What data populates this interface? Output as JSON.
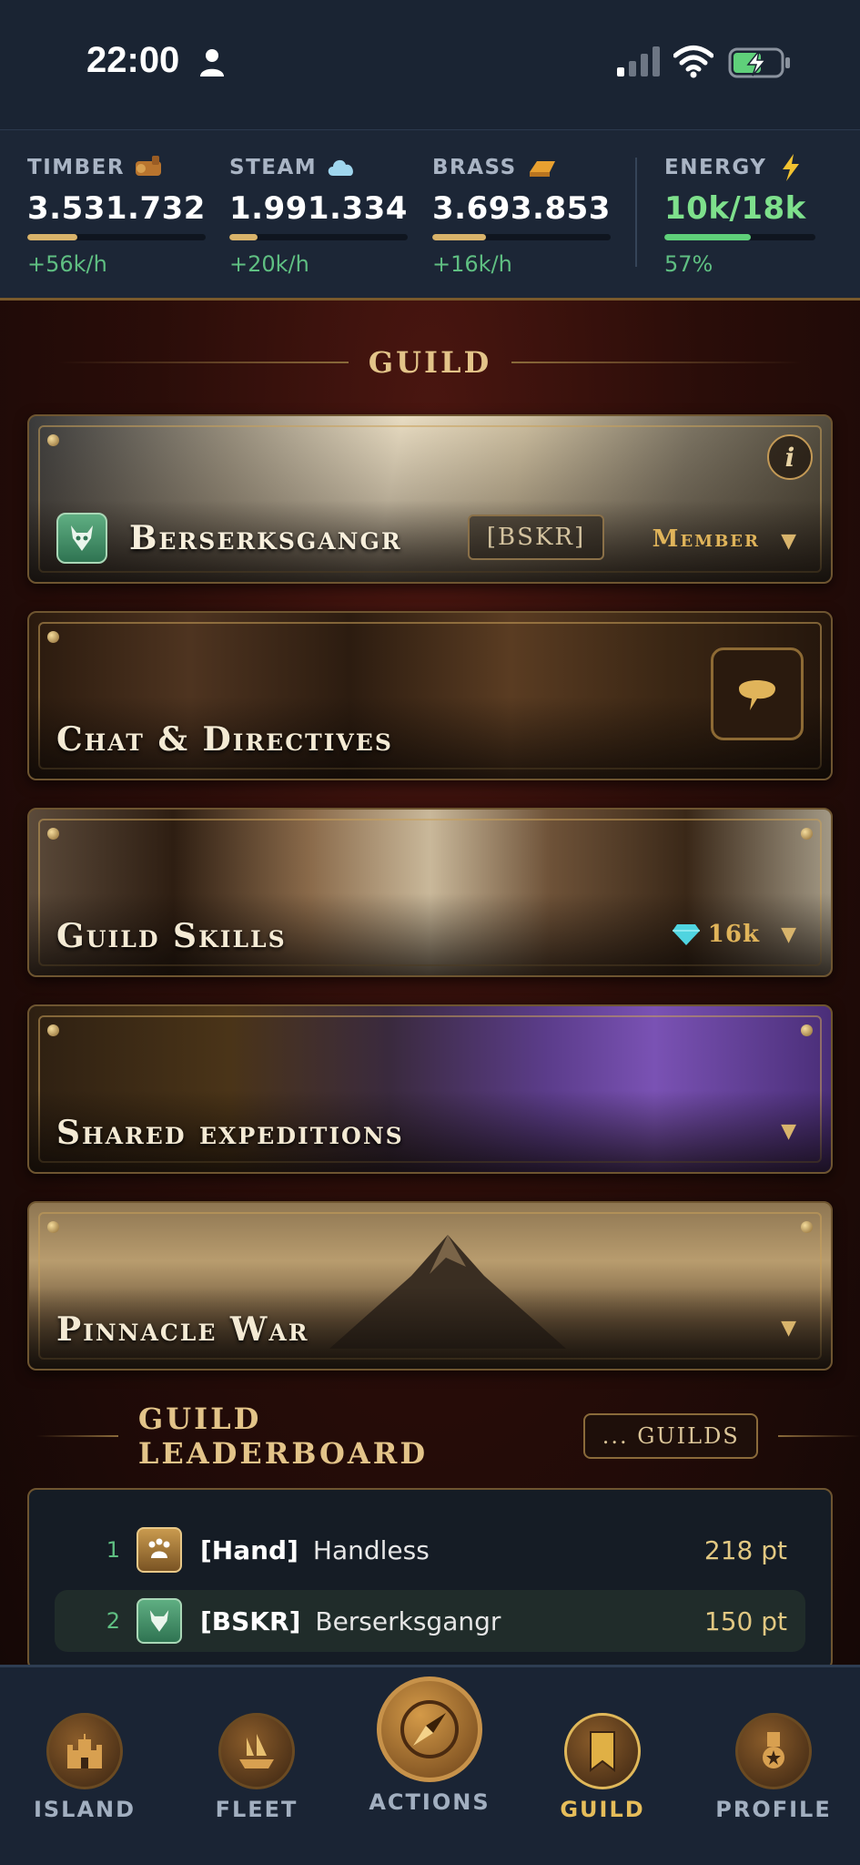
{
  "status_bar": {
    "time": "22:00"
  },
  "resources": [
    {
      "name": "TIMBER",
      "icon": "timber-icon",
      "value": "3.531.732",
      "rate": "+56k/h",
      "fill": 0.28
    },
    {
      "name": "STEAM",
      "icon": "steam-cloud-icon",
      "value": "1.991.334",
      "rate": "+20k/h",
      "fill": 0.16
    },
    {
      "name": "BRASS",
      "icon": "brass-ingot-icon",
      "value": "3.693.853",
      "rate": "+16k/h",
      "fill": 0.3
    }
  ],
  "energy": {
    "name": "ENERGY",
    "icon": "lightning-icon",
    "value": "10k/18k",
    "percent": "57%"
  },
  "guild_section": {
    "title": "GUILD"
  },
  "guild_card": {
    "name": "Berserksgangr",
    "tag": "[BSKR]",
    "role": "Member",
    "info_label": "i"
  },
  "cards": {
    "chat": "Chat & Directives",
    "skills": "Guild Skills",
    "skills_cost": "16k",
    "expeditions": "Shared expeditions",
    "war": "Pinnacle War"
  },
  "leaderboard": {
    "title": "GUILD LEADERBOARD",
    "filter": "... GUILDS",
    "rows": [
      {
        "rank": "1",
        "tag": "[Hand]",
        "name": "Handless",
        "points": "218 pt"
      },
      {
        "rank": "2",
        "tag": "[BSKR]",
        "name": "Berserksgangr",
        "points": "150 pt"
      }
    ]
  },
  "nav": [
    {
      "label": "ISLAND",
      "icon": "castle-icon"
    },
    {
      "label": "FLEET",
      "icon": "ship-icon"
    },
    {
      "label": "ACTIONS",
      "icon": "compass-icon"
    },
    {
      "label": "GUILD",
      "icon": "banner-icon",
      "active": true
    },
    {
      "label": "PROFILE",
      "icon": "medal-icon"
    }
  ],
  "colors": {
    "accent_gold": "#e0b45a",
    "positive_green": "#5fbf82",
    "energy_green": "#7ee08c",
    "header_bg": "#1c2636"
  }
}
